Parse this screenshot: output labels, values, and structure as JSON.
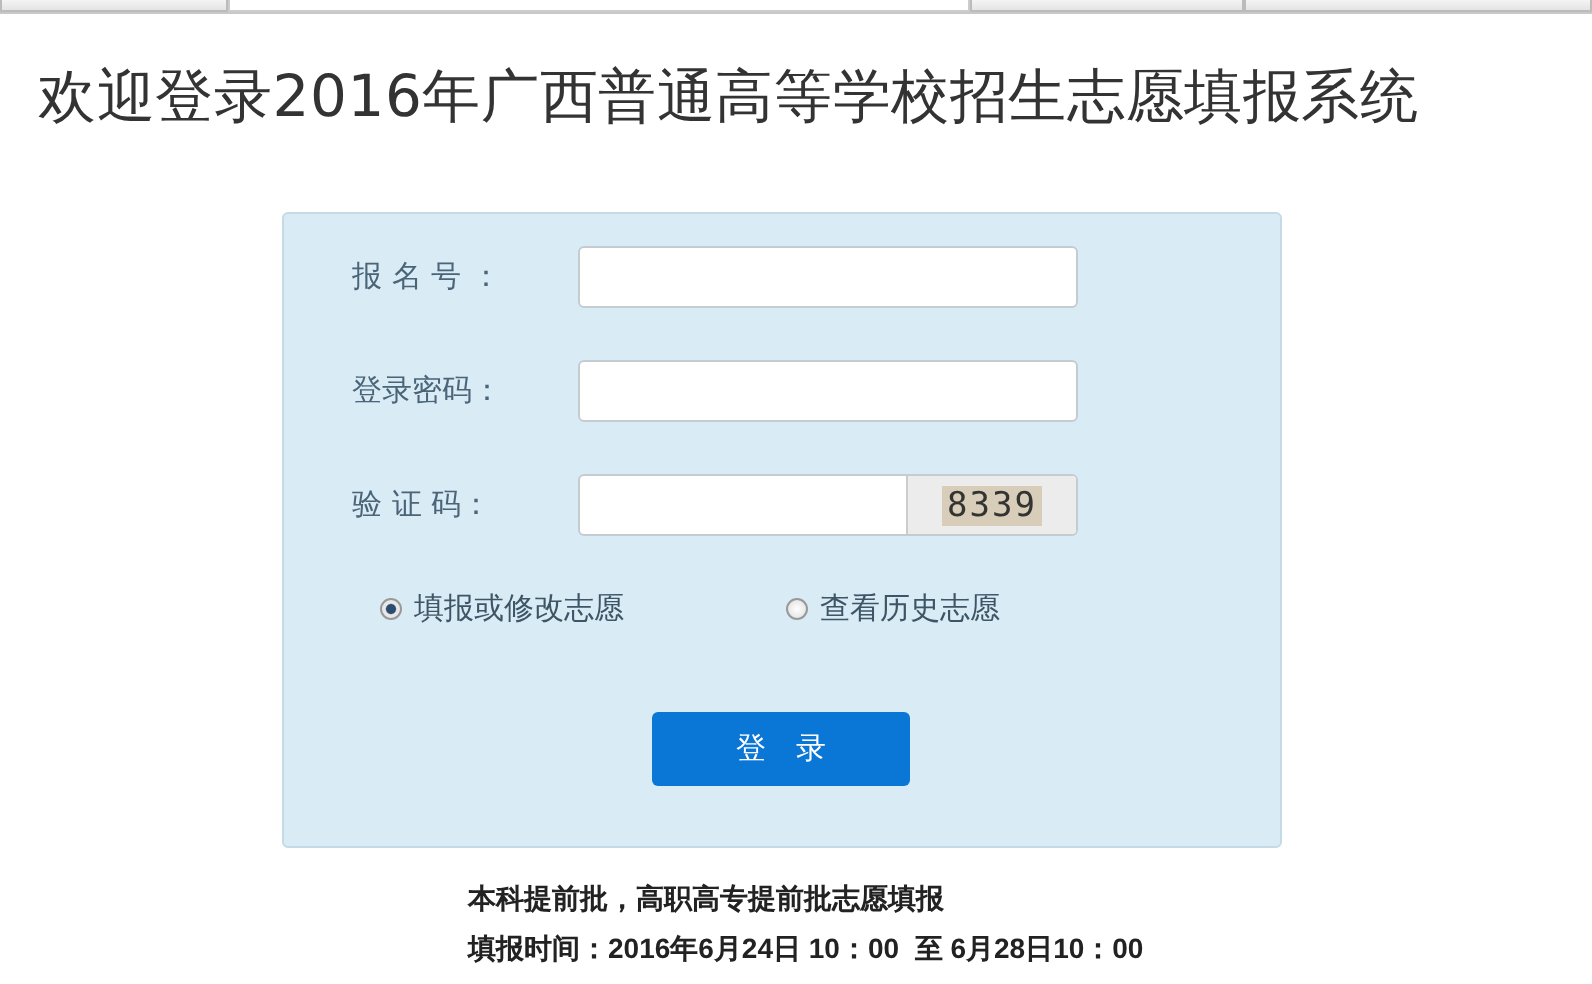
{
  "browser_tabs": [
    {
      "selected": false
    },
    {
      "selected": true
    },
    {
      "selected": false
    },
    {
      "selected": false
    }
  ],
  "title": "欢迎登录2016年广西普通高等学校招生志愿填报系统",
  "form": {
    "fields": [
      {
        "label": "报 名 号 ：",
        "kind": "text"
      },
      {
        "label": "登录密码：",
        "kind": "password"
      },
      {
        "label": "验 证 码：",
        "kind": "captcha",
        "captcha": "8339"
      }
    ],
    "options": [
      {
        "label": "填报或修改志愿",
        "selected": true
      },
      {
        "label": "查看历史志愿",
        "selected": false
      }
    ],
    "submit": "登　录"
  },
  "notice": [
    "本科提前批，高职高专提前批志愿填报",
    "填报时间：2016年6月24日 10：00  至 6月28日10：00"
  ]
}
